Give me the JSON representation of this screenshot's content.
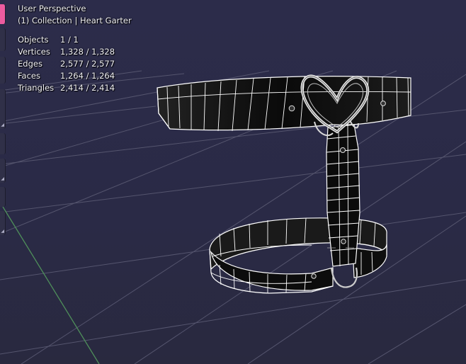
{
  "viewport": {
    "view_name": "User Perspective",
    "collection_line": "(1) Collection | Heart Garter",
    "background": "#2a2a46",
    "grid_color": "#5a5a74",
    "y_axis_color": "#4f8f5a",
    "wire_color": "#ffffff",
    "mesh_color": "#0b0b0b",
    "accent_tool_color": "#ec5b9f"
  },
  "stats": [
    {
      "label": "Objects",
      "value": "1 / 1"
    },
    {
      "label": "Vertices",
      "value": "1,328 / 1,328"
    },
    {
      "label": "Edges",
      "value": "2,577 / 2,577"
    },
    {
      "label": "Faces",
      "value": "1,264 / 1,264"
    },
    {
      "label": "Triangles",
      "value": "2,414 / 2,414"
    }
  ],
  "object": {
    "name": "Heart Garter",
    "icons": [
      "heart-buckle-icon",
      "rivet-icon"
    ]
  }
}
